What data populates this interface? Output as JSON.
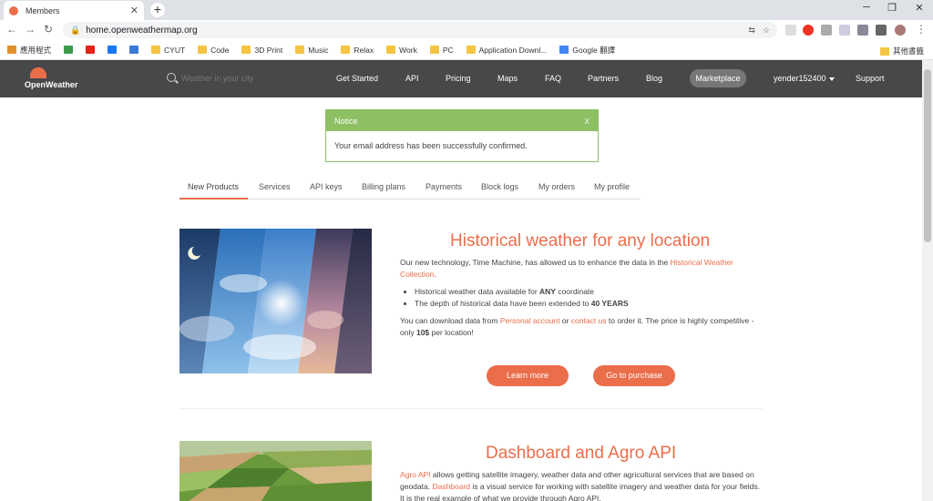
{
  "browser": {
    "tab_title": "Members",
    "tab_close": "✕",
    "new_tab": "+",
    "minimize": "─",
    "maximize": "❐",
    "close": "✕",
    "back": "←",
    "forward": "→",
    "reload": "↻",
    "url": "home.openweathermap.org",
    "bookmarks": [
      {
        "label": "應用程式",
        "color": "#e0902c"
      },
      {
        "label": "",
        "color": "#3a9b4b"
      },
      {
        "label": "",
        "color": "#e62117"
      },
      {
        "label": "",
        "color": "#1877f2"
      },
      {
        "label": "",
        "color": "#3a7bd5"
      },
      {
        "label": "CYUT",
        "color": "#f4c542"
      },
      {
        "label": "Code",
        "color": "#f4c542"
      },
      {
        "label": "3D Print",
        "color": "#f4c542"
      },
      {
        "label": "Music",
        "color": "#f4c542"
      },
      {
        "label": "Relax",
        "color": "#f4c542"
      },
      {
        "label": "Work",
        "color": "#f4c542"
      },
      {
        "label": "PC",
        "color": "#f4c542"
      },
      {
        "label": "Application Downl...",
        "color": "#f4c542"
      },
      {
        "label": "Google 翻譯",
        "color": "#4285f4"
      }
    ],
    "other_bookmarks": "其他書籤"
  },
  "header": {
    "logo_text": "OpenWeather",
    "search_placeholder": "Weather in your city",
    "nav": [
      {
        "label": "Get Started"
      },
      {
        "label": "API"
      },
      {
        "label": "Pricing"
      },
      {
        "label": "Maps"
      },
      {
        "label": "FAQ"
      },
      {
        "label": "Partners"
      },
      {
        "label": "Blog"
      }
    ],
    "marketplace": "Marketplace",
    "user": "yender152400",
    "support": "Support"
  },
  "notice": {
    "title": "Notice",
    "close": "x",
    "message": "Your email address has been successfully confirmed."
  },
  "tabs": [
    {
      "label": "New Products",
      "active": true
    },
    {
      "label": "Services"
    },
    {
      "label": "API keys"
    },
    {
      "label": "Billing plans"
    },
    {
      "label": "Payments"
    },
    {
      "label": "Block logs"
    },
    {
      "label": "My orders"
    },
    {
      "label": "My profile"
    }
  ],
  "product1": {
    "title": "Historical weather for any location",
    "intro_before": "Our new technology, Time Machine, has allowed us to enhance the data in the ",
    "intro_link": "Historical Weather Collection",
    "intro_after": ".",
    "bullet1_before": "Historical weather data available for ",
    "bullet1_bold": "ANY",
    "bullet1_after": " coordinate",
    "bullet2_before": "The depth of historical data have been extended to ",
    "bullet2_bold": "40 YEARS",
    "download_before": "You can download data from ",
    "download_link1": "Personal account",
    "download_mid": " or ",
    "download_link2": "contact us",
    "download_after": " to order it. The price is highly competitive - only ",
    "download_price": "10$",
    "download_end": " per location!",
    "learn_more": "Learn more",
    "purchase": "Go to purchase"
  },
  "product2": {
    "title": "Dashboard and Agro API",
    "link1": "Agro API",
    "text1": " allows getting satellite imagery, weather data and other agricultural services that are based on geodata. ",
    "link2": "Dashboard",
    "text2": " is a visual service for working with satellite imagery and weather data for your fields. It is the real example of what we provide through Agro API."
  },
  "colors": {
    "accent": "#eb6e4b",
    "header_bg": "#48484a",
    "notice_green": "#8cc063"
  }
}
